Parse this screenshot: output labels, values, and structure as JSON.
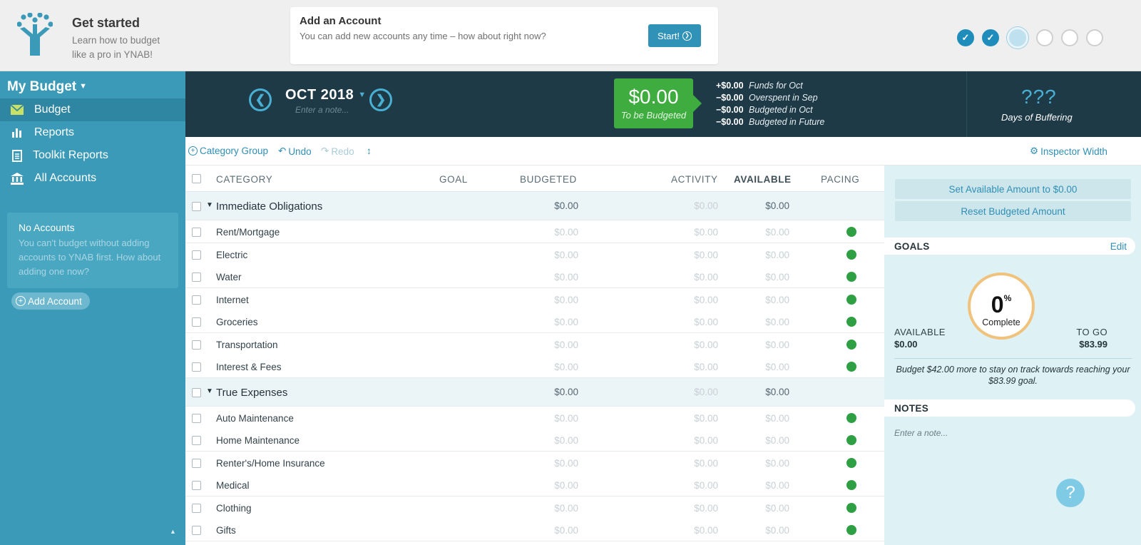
{
  "onboarding": {
    "title": "Get started",
    "subtitle": "Learn how to budget like a pro in YNAB!",
    "card_title": "Add an Account",
    "card_text": "You can add new accounts any time – how about right now?",
    "start_label": "Start!",
    "steps": [
      "done",
      "done",
      "current",
      "todo",
      "todo",
      "todo"
    ]
  },
  "sidebar": {
    "budget_name": "My Budget",
    "items": [
      {
        "label": "Budget",
        "icon": "envelope-icon"
      },
      {
        "label": "Reports",
        "icon": "bar-chart-icon"
      },
      {
        "label": "Toolkit Reports",
        "icon": "document-icon"
      },
      {
        "label": "All Accounts",
        "icon": "bank-icon"
      }
    ],
    "no_accounts_title": "No Accounts",
    "no_accounts_text": "You can't budget without adding accounts to YNAB first. How about adding one now?",
    "add_account_label": "Add Account"
  },
  "header": {
    "month": "OCT 2018",
    "note_placeholder": "Enter a note...",
    "to_be_budgeted_amount": "$0.00",
    "to_be_budgeted_label": "To be Budgeted",
    "funds": [
      {
        "amount": "+$0.00",
        "label": "Funds for Oct"
      },
      {
        "amount": "−$0.00",
        "label": "Overspent in Sep"
      },
      {
        "amount": "−$0.00",
        "label": "Budgeted in Oct"
      },
      {
        "amount": "−$0.00",
        "label": "Budgeted in Future"
      }
    ],
    "buffer_value": "???",
    "buffer_label": "Days of Buffering"
  },
  "toolbar": {
    "category_group": "Category Group",
    "undo": "Undo",
    "redo": "Redo",
    "inspector_width": "Inspector Width"
  },
  "table": {
    "headers": {
      "category": "CATEGORY",
      "goal": "GOAL",
      "budgeted": "BUDGETED",
      "activity": "ACTIVITY",
      "available": "AVAILABLE",
      "pacing": "PACING"
    },
    "groups": [
      {
        "name": "Immediate Obligations",
        "budgeted": "$0.00",
        "activity": "$0.00",
        "available": "$0.00",
        "categories": [
          {
            "name": "Rent/Mortgage",
            "budgeted": "$0.00",
            "activity": "$0.00",
            "available": "$0.00"
          },
          {
            "name": "Electric",
            "budgeted": "$0.00",
            "activity": "$0.00",
            "available": "$0.00"
          },
          {
            "name": "Water",
            "budgeted": "$0.00",
            "activity": "$0.00",
            "available": "$0.00"
          },
          {
            "name": "Internet",
            "budgeted": "$0.00",
            "activity": "$0.00",
            "available": "$0.00"
          },
          {
            "name": "Groceries",
            "budgeted": "$0.00",
            "activity": "$0.00",
            "available": "$0.00"
          },
          {
            "name": "Transportation",
            "budgeted": "$0.00",
            "activity": "$0.00",
            "available": "$0.00"
          },
          {
            "name": "Interest & Fees",
            "budgeted": "$0.00",
            "activity": "$0.00",
            "available": "$0.00"
          }
        ]
      },
      {
        "name": "True Expenses",
        "budgeted": "$0.00",
        "activity": "$0.00",
        "available": "$0.00",
        "categories": [
          {
            "name": "Auto Maintenance",
            "budgeted": "$0.00",
            "activity": "$0.00",
            "available": "$0.00"
          },
          {
            "name": "Home Maintenance",
            "budgeted": "$0.00",
            "activity": "$0.00",
            "available": "$0.00"
          },
          {
            "name": "Renter's/Home Insurance",
            "budgeted": "$0.00",
            "activity": "$0.00",
            "available": "$0.00"
          },
          {
            "name": "Medical",
            "budgeted": "$0.00",
            "activity": "$0.00",
            "available": "$0.00"
          },
          {
            "name": "Clothing",
            "budgeted": "$0.00",
            "activity": "$0.00",
            "available": "$0.00"
          },
          {
            "name": "Gifts",
            "budgeted": "$0.00",
            "activity": "$0.00",
            "available": "$0.00"
          }
        ]
      }
    ]
  },
  "inspector": {
    "set_available": "Set Available Amount to $0.00",
    "reset_budgeted": "Reset Budgeted Amount",
    "goals_title": "GOALS",
    "edit": "Edit",
    "percent": "0",
    "percent_sign": "%",
    "complete": "Complete",
    "available_label": "AVAILABLE",
    "available_value": "$0.00",
    "to_go_label": "TO GO",
    "to_go_value": "$83.99",
    "goal_message": "Budget $42.00 more to stay on track towards reaching your $83.99 goal.",
    "notes_title": "NOTES",
    "notes_placeholder": "Enter a note..."
  },
  "help_label": "?",
  "colors": {
    "accent": "#3192b8",
    "sidebar": "#3a9ab8",
    "header": "#1f3a47",
    "to_be_budgeted": "#3eac3e",
    "pacing_ok": "#2ea043",
    "goal_ring": "#f0c27b"
  }
}
